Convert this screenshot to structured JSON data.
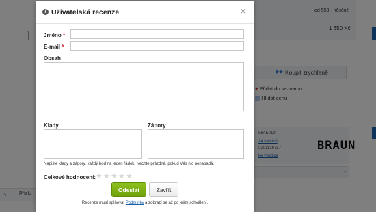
{
  "background": {
    "price_note": "od 550,- něsčně",
    "price": "1 650 Kč",
    "buy_fast_label": "Koupit zrychleně",
    "add_to_list_label": "Přidat do seznamu",
    "watch_price_label": "Hlídat cenu",
    "brand_logo": "BRAUN",
    "code_line": "86AE019",
    "stock_line": "24 měsíců",
    "ean_line": "0201139757",
    "link_line": "ke výrobce",
    "breadcrumb_label": "Příslu"
  },
  "modal": {
    "title": "Uživatelská recenze",
    "name_label": "Jméno",
    "email_label": "E-mail",
    "required_mark": "*",
    "content_label": "Obsah",
    "pros_label": "Klady",
    "cons_label": "Zápory",
    "hint": "Napište klady a zápory, každý bod na jeden řádek. Nechte prázdné, pokud Vás nic nenapadá.",
    "rating_label": "Celkové hodnocení:",
    "rating_value": 0,
    "rating_max": 5,
    "send_label": "Odeslat",
    "close_label": "Zavřít",
    "footer_before": "Recenze musí splňovat",
    "footer_link": "Podmínky",
    "footer_after": "a zobrazí se až po jejím schválení."
  },
  "colors": {
    "overlay": "#000000",
    "send_button": "#7cb013",
    "required": "#d2232a",
    "link": "#1a5faa"
  }
}
